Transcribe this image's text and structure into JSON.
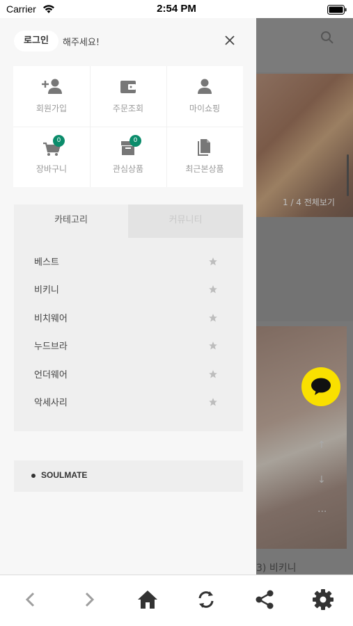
{
  "status_bar": {
    "carrier": "Carrier",
    "time": "2:54 PM"
  },
  "drawer": {
    "login_label": "로그인",
    "login_suffix": "해주세요!",
    "shortcuts": [
      {
        "label": "회원가입",
        "icon": "add-user-icon"
      },
      {
        "label": "주문조회",
        "icon": "wallet-icon"
      },
      {
        "label": "마이쇼핑",
        "icon": "user-icon"
      },
      {
        "label": "장바구니",
        "icon": "cart-icon",
        "badge": "0"
      },
      {
        "label": "관심상품",
        "icon": "box-icon",
        "badge": "0"
      },
      {
        "label": "최근본상품",
        "icon": "document-icon"
      }
    ],
    "tabs": {
      "category": "카테고리",
      "community": "커뮤니티"
    },
    "categories": [
      "베스트",
      "비키니",
      "비치웨어",
      "누드브라",
      "언더웨어",
      "악세사리"
    ],
    "brand_item": "SOULMATE"
  },
  "background_page": {
    "banner_counter": "1 / 4   전체보기",
    "product_name": "3) 비키니"
  },
  "toolbar": {
    "buttons": [
      "back-icon",
      "forward-icon",
      "home-icon",
      "refresh-icon",
      "share-icon",
      "settings-icon"
    ]
  },
  "colors": {
    "badge": "#0b8c6b",
    "kakao": "#f9e000"
  }
}
